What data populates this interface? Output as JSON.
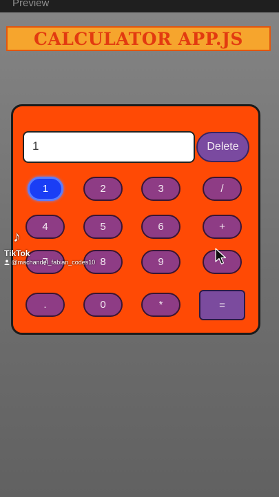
{
  "preview_bar": {
    "label": "Preview"
  },
  "title": "CALCULATOR APP.JS",
  "display": {
    "value": "1"
  },
  "delete_label": "Delete",
  "keys": [
    "1",
    "2",
    "3",
    "/",
    "4",
    "5",
    "6",
    "+",
    "7",
    "8",
    "9",
    "-",
    ".",
    "0",
    "*",
    "="
  ],
  "active_key": "1",
  "overlay": {
    "logo_icon": "tiktok-note-icon",
    "brand": "TikTok",
    "username": "@machandel_fabian_codes10"
  },
  "colors": {
    "card": "#ff4a05",
    "key": "#8e3c85",
    "key_active": "#1a3ef5",
    "title_bg": "#f6a52d",
    "title_text": "#e23b10"
  }
}
